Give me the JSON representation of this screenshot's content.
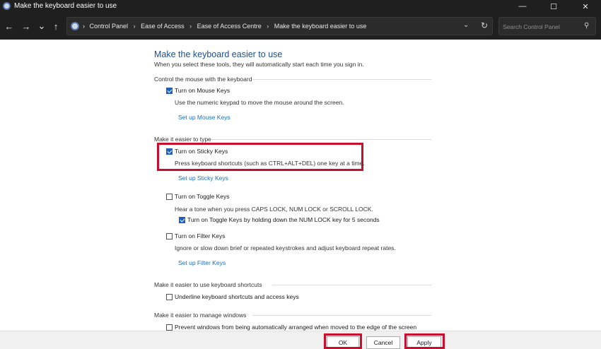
{
  "window": {
    "title": "Make the keyboard easier to use",
    "minimize_glyph": "—",
    "maximize_glyph": "☐",
    "close_glyph": "✕"
  },
  "nav": {
    "back_glyph": "←",
    "forward_glyph": "→",
    "recent_glyph": "⌄",
    "up_glyph": "↑",
    "dropdown_glyph": "⌄",
    "refresh_glyph": "↻",
    "search_glyph": "⚲"
  },
  "address": {
    "breadcrumbs": [
      "Control Panel",
      "Ease of Access",
      "Ease of Access Centre",
      "Make the keyboard easier to use"
    ],
    "separator": "›"
  },
  "search": {
    "placeholder": "Search Control Panel"
  },
  "main": {
    "heading": "Make the keyboard easier to use",
    "intro": "When you select these tools, they will automatically start each time you sign in.",
    "sections": {
      "mouse": {
        "label": "Control the mouse with the keyboard",
        "mouse_keys": {
          "label": "Turn on Mouse Keys",
          "checked": true
        },
        "mouse_keys_desc": "Use the numeric keypad to move the mouse around the screen.",
        "mouse_keys_link": "Set up Mouse Keys"
      },
      "typing": {
        "label": "Make it easier to type",
        "sticky_keys": {
          "label": "Turn on Sticky Keys",
          "checked": true
        },
        "sticky_keys_desc": "Press keyboard shortcuts (such as CTRL+ALT+DEL) one key at a time.",
        "sticky_keys_link": "Set up Sticky Keys",
        "toggle_keys": {
          "label": "Turn on Toggle Keys",
          "checked": false
        },
        "toggle_keys_desc": "Hear a tone when you press CAPS LOCK, NUM LOCK or SCROLL LOCK.",
        "toggle_keys_hold": {
          "label": "Turn on Toggle Keys by holding down the NUM LOCK key for 5 seconds",
          "checked": true
        },
        "filter_keys": {
          "label": "Turn on Filter Keys",
          "checked": false
        },
        "filter_keys_desc": "Ignore or slow down brief or repeated keystrokes and adjust keyboard repeat rates.",
        "filter_keys_link": "Set up Filter Keys"
      },
      "shortcuts": {
        "label": "Make it easier to use keyboard shortcuts",
        "underline": {
          "label": "Underline keyboard shortcuts and access keys",
          "checked": false
        }
      },
      "windows": {
        "label": "Make it easier to manage windows",
        "prevent_arrange": {
          "label": "Prevent windows from being automatically arranged when moved to the edge of the screen",
          "checked": false
        }
      }
    }
  },
  "footer": {
    "ok": "OK",
    "cancel": "Cancel",
    "apply": "Apply"
  },
  "colors": {
    "highlight": "#c8102e",
    "heading": "#1e4e8c",
    "link": "#1a6fc4",
    "checkbox": "#1f5fbf"
  }
}
